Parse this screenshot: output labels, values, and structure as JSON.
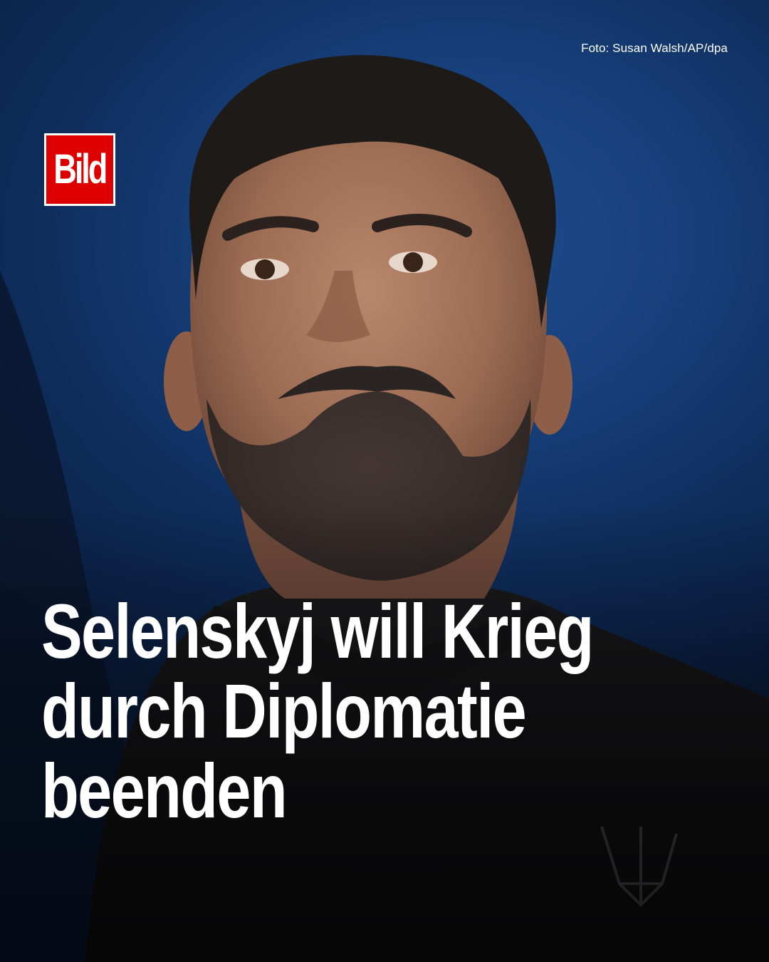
{
  "photo_credit": "Foto: Susan Walsh/AP/dpa",
  "logo": {
    "text": "Bild",
    "color": "#de0000"
  },
  "headline": {
    "lines": [
      "Selenskyj will Krieg",
      "durch Diplomatie",
      "beenden"
    ]
  },
  "colors": {
    "background": "#17407b",
    "text": "#ffffff"
  }
}
